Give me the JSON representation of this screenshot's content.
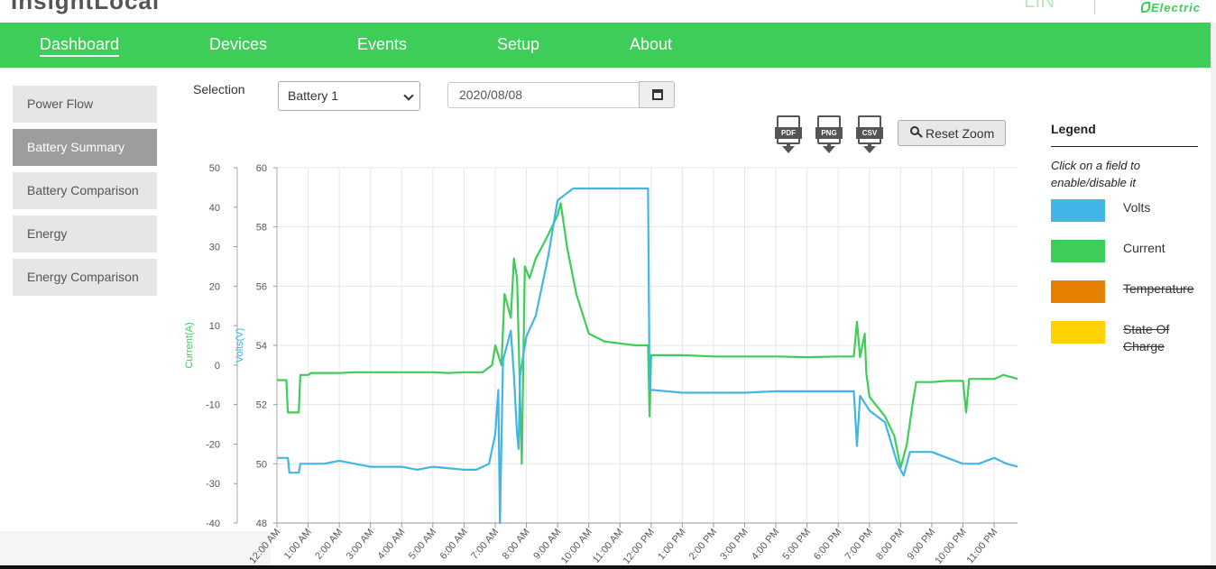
{
  "brand": {
    "left_text": "InsightLocal",
    "right_text": "Electric",
    "faint_text": "LIN"
  },
  "nav": {
    "items": [
      {
        "label": "Dashboard",
        "active": true
      },
      {
        "label": "Devices",
        "active": false
      },
      {
        "label": "Events",
        "active": false
      },
      {
        "label": "Setup",
        "active": false
      },
      {
        "label": "About",
        "active": false
      }
    ]
  },
  "sidebar": {
    "items": [
      {
        "label": "Power Flow",
        "active": false
      },
      {
        "label": "Battery Summary",
        "active": true
      },
      {
        "label": "Battery Comparison",
        "active": false
      },
      {
        "label": "Energy",
        "active": false
      },
      {
        "label": "Energy Comparison",
        "active": false
      }
    ]
  },
  "controls": {
    "selection_label": "Selection",
    "selection_value": "Battery 1",
    "date_value": "2020/08/08",
    "exports": [
      "PDF",
      "PNG",
      "CSV"
    ],
    "reset_zoom_label": "Reset Zoom"
  },
  "legend": {
    "title": "Legend",
    "hint": "Click on a field to enable/disable it",
    "items": [
      {
        "label": "Volts",
        "color": "#41b6e6",
        "enabled": true
      },
      {
        "label": "Current",
        "color": "#3dcd58",
        "enabled": true
      },
      {
        "label": "Temperature",
        "color": "#e47f00",
        "enabled": false
      },
      {
        "label": "State Of Charge",
        "color": "#ffd100",
        "enabled": false
      }
    ]
  },
  "chart_data": {
    "type": "line",
    "left_axis_label": "Current(A)",
    "right_axis_label": "Volts(V)",
    "current_axis": {
      "range": [
        -40,
        50
      ],
      "ticks": [
        50,
        40,
        30,
        20,
        10,
        0,
        -10,
        -20,
        -30,
        -40
      ]
    },
    "volts_axis": {
      "range": [
        48,
        60
      ],
      "ticks": [
        60,
        58,
        56,
        54,
        52,
        50,
        48
      ]
    },
    "x_tick_labels": [
      "12:00 AM",
      "1:00 AM",
      "2:00 AM",
      "3:00 AM",
      "4:00 AM",
      "5:00 AM",
      "6:00 AM",
      "7:00 AM",
      "8:00 AM",
      "9:00 AM",
      "10:00 AM",
      "11:00 AM",
      "12:00 PM",
      "1:00 PM",
      "2:00 PM",
      "3:00 PM",
      "4:00 PM",
      "5:00 PM",
      "6:00 PM",
      "7:00 PM",
      "8:00 PM",
      "9:00 PM",
      "10:00 PM",
      "11:00 PM"
    ],
    "x_range_hours": [
      0,
      23.75
    ],
    "grid": true,
    "series": [
      {
        "name": "Current",
        "color": "#3dcd58",
        "axis": "current",
        "points": [
          [
            0,
            -3.8
          ],
          [
            0.3,
            -3.8
          ],
          [
            0.35,
            -12
          ],
          [
            0.7,
            -12
          ],
          [
            0.75,
            -2.5
          ],
          [
            1.0,
            -2.5
          ],
          [
            1.1,
            -2.0
          ],
          [
            2.0,
            -2.0
          ],
          [
            2.5,
            -1.8
          ],
          [
            3.5,
            -1.8
          ],
          [
            4.0,
            -1.8
          ],
          [
            5.0,
            -1.8
          ],
          [
            5.5,
            -2.0
          ],
          [
            6.0,
            -1.8
          ],
          [
            6.6,
            -1.8
          ],
          [
            6.9,
            0
          ],
          [
            7.0,
            5
          ],
          [
            7.2,
            0
          ],
          [
            7.3,
            18
          ],
          [
            7.5,
            12
          ],
          [
            7.6,
            27
          ],
          [
            7.7,
            22
          ],
          [
            7.85,
            -25
          ],
          [
            7.95,
            25
          ],
          [
            8.1,
            22
          ],
          [
            8.3,
            27
          ],
          [
            8.5,
            30
          ],
          [
            8.7,
            33
          ],
          [
            9.0,
            38
          ],
          [
            9.1,
            41
          ],
          [
            9.3,
            30
          ],
          [
            9.6,
            18
          ],
          [
            10.0,
            8
          ],
          [
            10.5,
            6
          ],
          [
            11.0,
            5.5
          ],
          [
            11.5,
            5
          ],
          [
            11.9,
            5
          ],
          [
            11.95,
            -13
          ],
          [
            12.0,
            2.5
          ],
          [
            13.0,
            2.5
          ],
          [
            14.0,
            2.2
          ],
          [
            15.0,
            2.2
          ],
          [
            16.0,
            2.2
          ],
          [
            17.0,
            2.0
          ],
          [
            18.0,
            2.2
          ],
          [
            18.5,
            2.2
          ],
          [
            18.6,
            11
          ],
          [
            18.7,
            2
          ],
          [
            18.85,
            8
          ],
          [
            18.9,
            -2
          ],
          [
            19.0,
            -8
          ],
          [
            19.5,
            -13
          ],
          [
            19.8,
            -18
          ],
          [
            20.0,
            -26
          ],
          [
            20.2,
            -20
          ],
          [
            20.4,
            -9
          ],
          [
            20.5,
            -4.3
          ],
          [
            21.0,
            -4.3
          ],
          [
            21.5,
            -4.0
          ],
          [
            22.0,
            -4.0
          ],
          [
            22.1,
            -12
          ],
          [
            22.2,
            -3.5
          ],
          [
            23.0,
            -3.5
          ],
          [
            23.3,
            -2.5
          ],
          [
            23.75,
            -3.5
          ]
        ]
      },
      {
        "name": "Volts",
        "color": "#41b6e6",
        "axis": "volts",
        "points": [
          [
            0,
            50.2
          ],
          [
            0.35,
            50.2
          ],
          [
            0.4,
            49.7
          ],
          [
            0.7,
            49.7
          ],
          [
            0.75,
            50.0
          ],
          [
            1.5,
            50.0
          ],
          [
            2.0,
            50.1
          ],
          [
            2.5,
            50.0
          ],
          [
            3.0,
            49.9
          ],
          [
            4.0,
            49.9
          ],
          [
            4.5,
            49.8
          ],
          [
            5.0,
            49.9
          ],
          [
            6.0,
            49.8
          ],
          [
            6.4,
            49.8
          ],
          [
            6.8,
            50.0
          ],
          [
            7.0,
            51
          ],
          [
            7.1,
            52.5
          ],
          [
            7.15,
            48
          ],
          [
            7.25,
            53.5
          ],
          [
            7.5,
            54.5
          ],
          [
            7.6,
            53
          ],
          [
            7.7,
            51
          ],
          [
            7.75,
            50.5
          ],
          [
            7.8,
            53
          ],
          [
            8.0,
            54.3
          ],
          [
            8.3,
            55
          ],
          [
            8.7,
            57
          ],
          [
            9.0,
            58.9
          ],
          [
            9.5,
            59.3
          ],
          [
            10.5,
            59.3
          ],
          [
            11.9,
            59.3
          ],
          [
            11.95,
            52.5
          ],
          [
            12.0,
            52.5
          ],
          [
            13.0,
            52.4
          ],
          [
            14.0,
            52.4
          ],
          [
            15.0,
            52.4
          ],
          [
            16.0,
            52.45
          ],
          [
            17.0,
            52.45
          ],
          [
            18.0,
            52.45
          ],
          [
            18.5,
            52.45
          ],
          [
            18.6,
            50.6
          ],
          [
            18.7,
            52.3
          ],
          [
            19.0,
            51.8
          ],
          [
            19.5,
            51.4
          ],
          [
            19.9,
            50.0
          ],
          [
            20.1,
            49.6
          ],
          [
            20.3,
            50.4
          ],
          [
            21.0,
            50.4
          ],
          [
            21.5,
            50.2
          ],
          [
            22.0,
            50.0
          ],
          [
            22.5,
            50.0
          ],
          [
            23.0,
            50.2
          ],
          [
            23.4,
            50.0
          ],
          [
            23.75,
            49.9
          ]
        ]
      }
    ]
  }
}
